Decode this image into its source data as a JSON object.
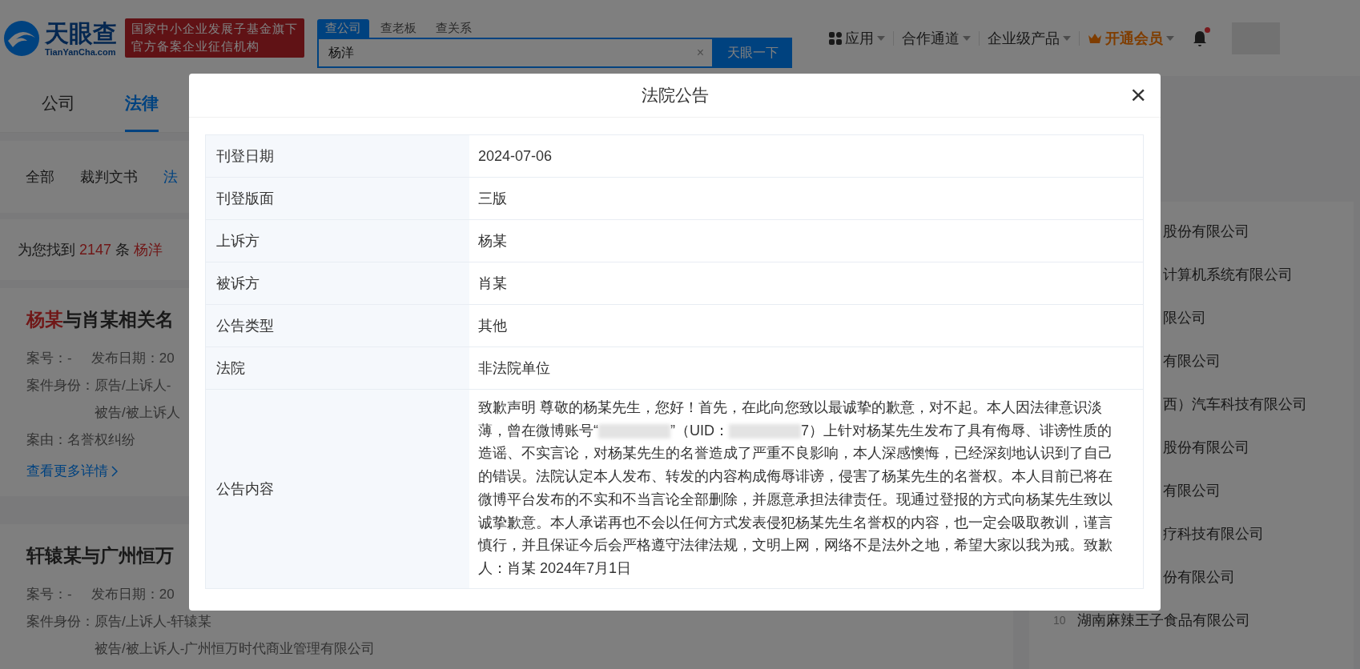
{
  "header": {
    "logo_text": "天眼查",
    "logo_sub": "TianYanCha.com",
    "badge_lines": [
      "国家中小企业发展子基金旗下",
      "官方备案企业征信机构"
    ],
    "search_tabs": [
      {
        "label": "查公司",
        "selected": true
      },
      {
        "label": "查老板",
        "selected": false
      },
      {
        "label": "查关系",
        "selected": false
      }
    ],
    "search": {
      "value": "杨洋",
      "clear": "×",
      "button": "天眼一下"
    },
    "nav": [
      {
        "label": "应用",
        "kind": "apps"
      },
      {
        "label": "合作通道",
        "kind": "plain"
      },
      {
        "label": "企业级产品",
        "kind": "plain"
      },
      {
        "label": "开通会员",
        "kind": "vip"
      }
    ],
    "notification": {
      "unread": true
    }
  },
  "main_tabs": [
    {
      "label": "公司",
      "selected": false
    },
    {
      "label": "法律",
      "selected": true
    }
  ],
  "sub_tabs": [
    {
      "label": "全部",
      "selected": false
    },
    {
      "label": "裁判文书",
      "selected": false
    },
    {
      "label": "法",
      "selected": true
    }
  ],
  "result_summary": [
    {
      "text": "为您找到 ",
      "highlight": false
    },
    {
      "text": "2147",
      "highlight": true
    },
    {
      "text": " 条 ",
      "highlight": false
    },
    {
      "text": "杨洋",
      "highlight": true
    }
  ],
  "results": [
    {
      "title": [
        {
          "text": "杨某",
          "highlight": true
        },
        {
          "text": "与肖某相关名",
          "highlight": false
        }
      ],
      "meta": [
        {
          "label": "案号：-",
          "extra": "发布日期：20"
        }
      ],
      "party_label": "案件身份：",
      "parties": [
        "原告/上诉人-",
        "被告/被上诉人"
      ],
      "cause": "案由：名誉权纠纷",
      "more": "查看更多详情"
    },
    {
      "title": [
        {
          "text": "轩辕某与广州恒万",
          "highlight": false
        }
      ],
      "meta": [
        {
          "label": "案号：-",
          "extra": "发布日期：20"
        }
      ],
      "party_label": "案件身份：",
      "parties": [
        "原告/上诉人-轩辕某",
        "被告/被上诉人-广州恒万时代商业管理有限公司"
      ]
    }
  ],
  "side_list": [
    {
      "name": "股份有限公司"
    },
    {
      "name": "计算机系统有限公司"
    },
    {
      "name": "限公司"
    },
    {
      "name": "有限公司"
    },
    {
      "name": "西）汽车科技有限公司"
    },
    {
      "name": "股份有限公司"
    },
    {
      "name": "有限公司"
    },
    {
      "name": "疗科技有限公司"
    },
    {
      "name": "份有限公司"
    },
    {
      "rank": "10",
      "name": "湖南麻辣王子食品有限公司"
    }
  ],
  "dialog": {
    "title": "法院公告",
    "close": "×",
    "rows": [
      {
        "label": "刊登日期",
        "value": "2024-07-06"
      },
      {
        "label": "刊登版面",
        "value": "三版"
      },
      {
        "label": "上诉方",
        "value": "杨某"
      },
      {
        "label": "被诉方",
        "value": "肖某"
      },
      {
        "label": "公告类型",
        "value": "其他"
      },
      {
        "label": "法院",
        "value": "非法院单位"
      }
    ],
    "content_label": "公告内容",
    "content": [
      {
        "kind": "text",
        "text": "致歉声明 尊敬的杨某先生，您好！首先，在此向您致以最诚挚的歉意，对不起。本人因法律意识淡薄，曾在微博账号“"
      },
      {
        "kind": "redacted"
      },
      {
        "kind": "text",
        "text": "”（UID："
      },
      {
        "kind": "redacted"
      },
      {
        "kind": "text",
        "text": "7）上针对杨某先生发布了具有侮辱、诽谤性质的造谣、不实言论，对杨某先生的名誉造成了严重不良影响，本人深感懊悔，已经深刻地认识到了自己的错误。法院认定本人发布、转发的内容构成侮辱诽谤，侵害了杨某先生的名誉权。本人目前已将在微博平台发布的不实和不当言论全部删除，并愿意承担法律责任。现通过登报的方式向杨某先生致以诚挚歉意。本人承诺再也不会以任何方式发表侵犯杨某先生名誉权的内容，也一定会吸取教训，谨言慎行，并且保证今后会严格遵守法律法规，文明上网，网络不是法外之地，希望大家以我为戒。致歉人：肖某 2024年7月1日"
      }
    ]
  }
}
